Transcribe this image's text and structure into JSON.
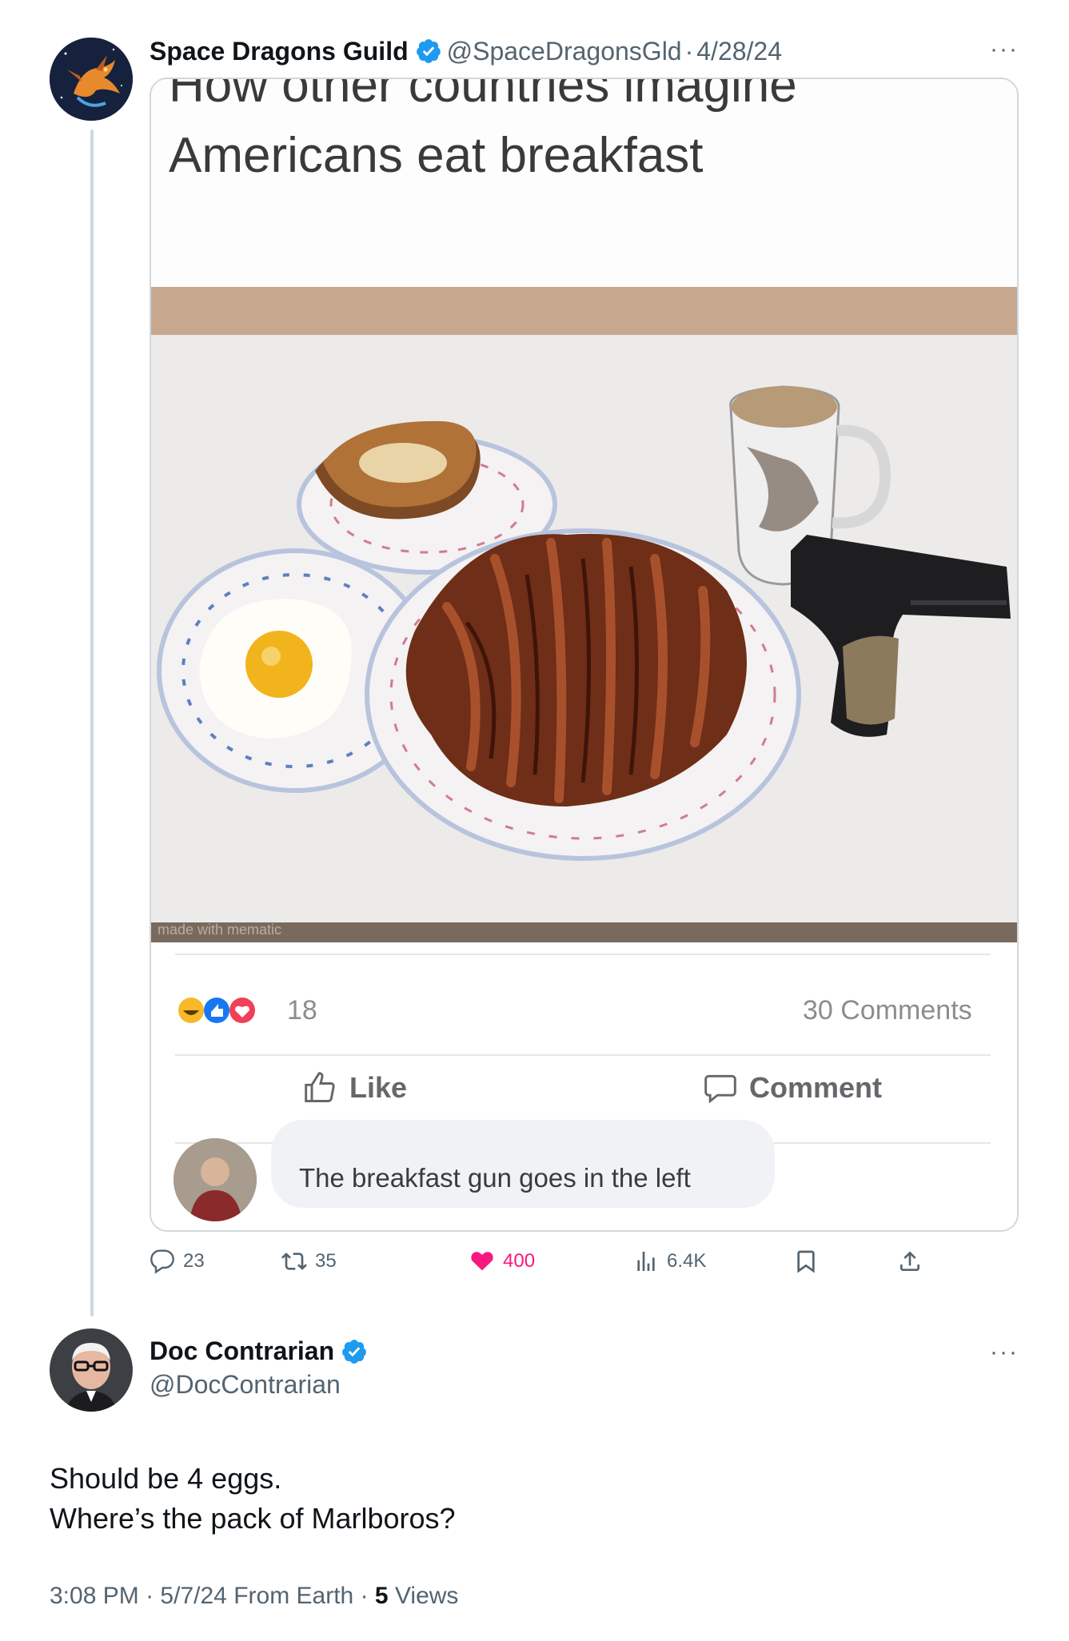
{
  "tweet1": {
    "author_name": "Space Dragons Guild",
    "handle": "@SpaceDragonsGld",
    "separator": "·",
    "date": "4/28/24",
    "more_label": "···",
    "media": {
      "caption_line1": "How other countries imagine",
      "caption_line2": "Americans eat breakfast",
      "watermark": "made with mematic",
      "fb_reaction_count": "18",
      "fb_comments_count": "30 Comments",
      "fb_like_label": "Like",
      "fb_comment_label": "Comment",
      "fb_comment_text": "The breakfast gun goes in the left"
    },
    "stats": {
      "replies": "23",
      "retweets": "35",
      "likes": "400",
      "views": "6.4K"
    }
  },
  "tweet2": {
    "author_name": "Doc Contrarian",
    "handle": "@DocContrarian",
    "more_label": "···",
    "body_line1": "Should be 4 eggs.",
    "body_line2": "Where’s the pack of Marlboros?",
    "time": "3:08 PM",
    "date": "5/7/24",
    "source": "From Earth",
    "separator": "·",
    "views_count": "5",
    "views_label": "Views"
  },
  "colors": {
    "verified_blue": "#1d9bf0",
    "like_pink": "#f91880",
    "muted": "#536471",
    "border": "#cfd9de"
  }
}
